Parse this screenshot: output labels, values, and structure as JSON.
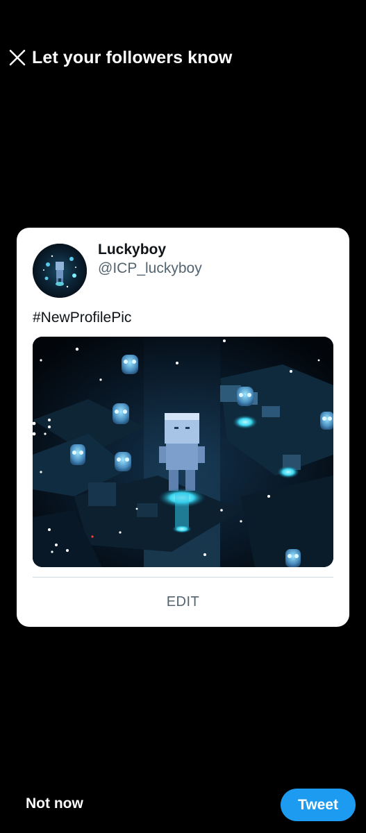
{
  "header": {
    "title": "Let your followers know",
    "close_icon": "close-icon"
  },
  "card": {
    "display_name": "Luckyboy",
    "handle": "@ICP_luckyboy",
    "text": "#NewProfilePic",
    "edit_label": "EDIT"
  },
  "footer": {
    "not_now_label": "Not now",
    "tweet_label": "Tweet"
  },
  "colors": {
    "background": "#000000",
    "card": "#ffffff",
    "accent": "#1d9bf0",
    "secondary_text": "#536471",
    "primary_text": "#0f1419"
  }
}
